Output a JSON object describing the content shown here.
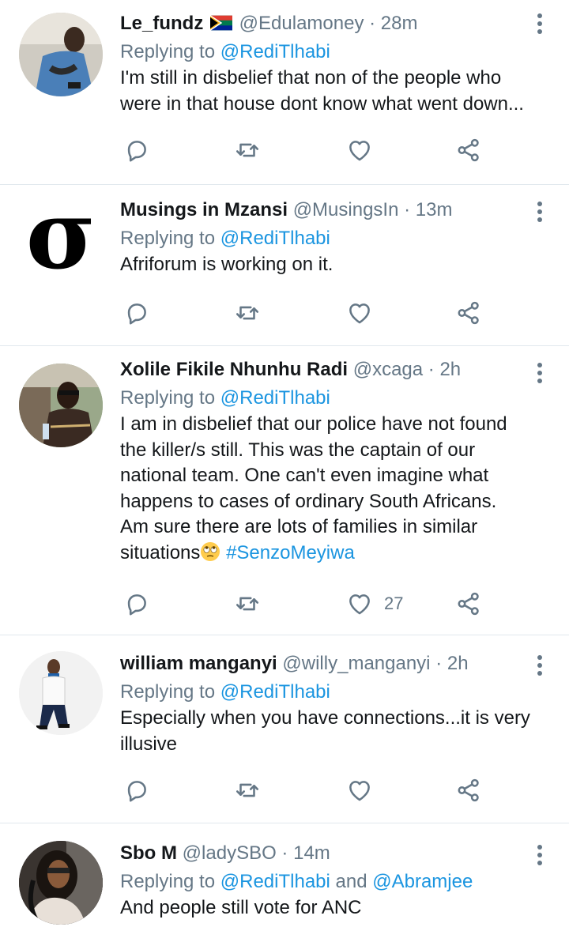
{
  "tweets": [
    {
      "name": "Le_fundz",
      "handle": "@Edulamoney",
      "time": "28m",
      "reply_prefix": "Replying to",
      "reply_to": "@RediTlhabi",
      "text_lines": [
        "I'm still in disbelief that non of the people who",
        "were in that house dont know what went down..."
      ],
      "likes": ""
    },
    {
      "name": "Musings in Mzansi",
      "handle": "@MusingsIn",
      "time": "13m",
      "reply_prefix": "Replying to",
      "reply_to": "@RediTlhabi",
      "text_lines": [
        "Afriforum is working on it."
      ],
      "likes": "",
      "avatar_glyph": "σ"
    },
    {
      "name": "Xolile Fikile Nhunhu Radi",
      "handle": "@xcaga",
      "time": "2h",
      "reply_prefix": "Replying to",
      "reply_to": "@RediTlhabi",
      "text_lines": [
        "I am in disbelief that our police have not found",
        "the killer/s still. This was the captain of our",
        "national team. One can't even imagine what",
        "happens to cases of ordinary South Africans.",
        "Am sure there are lots of families in similar"
      ],
      "last_line_text": "situations",
      "hashtag": "#SenzoMeyiwa",
      "likes": "27"
    },
    {
      "name": "william manganyi",
      "handle": "@willy_manganyi",
      "time": "2h",
      "reply_prefix": "Replying to",
      "reply_to": "@RediTlhabi",
      "text_lines": [
        "Especially when you have connections...it is very",
        "illusive"
      ],
      "likes": ""
    },
    {
      "name": "Sbo M",
      "handle": "@ladySBO",
      "time": "14m",
      "reply_prefix": "Replying to",
      "reply_to": "@RediTlhabi",
      "reply_and": "and",
      "reply_to_2": "@Abramjee",
      "text_lines": [
        "And people still vote for ANC"
      ],
      "likes": ""
    }
  ],
  "separator": "·",
  "icons": [
    "reply-icon",
    "retweet-icon",
    "like-icon",
    "share-icon",
    "more-options-icon"
  ],
  "colors": {
    "accent": "#1b95e0",
    "secondary_text": "#657786",
    "primary_text": "#14171a",
    "divider": "#e1e8ed"
  }
}
